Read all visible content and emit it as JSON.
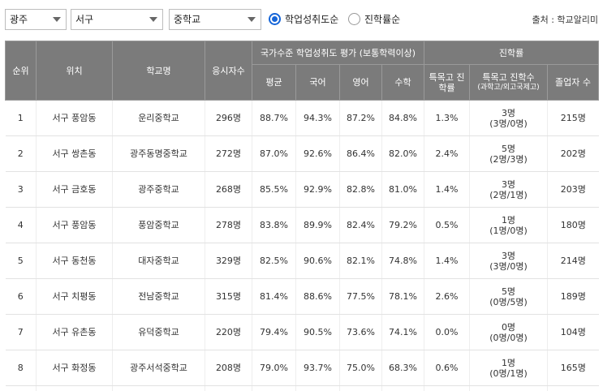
{
  "filters": {
    "region": "광주",
    "district": "서구",
    "school_level": "중학교",
    "sort_options": [
      {
        "label": "학업성취도순",
        "checked": true
      },
      {
        "label": "진학률순",
        "checked": false
      }
    ],
    "source": "출처 : 학교알리미"
  },
  "table": {
    "headers": {
      "rank": "순위",
      "location": "위치",
      "school": "학교명",
      "examinees": "응시자수",
      "achievement_group": "국가수준 학업성취도 평가 (보통학력이상)",
      "average": "평균",
      "korean": "국어",
      "english": "영어",
      "math": "수학",
      "advance_group": "진학률",
      "special_rate": "특목고 진학률",
      "special_count": "특목고 진학수",
      "special_count_sub": "(과학고/외고국제고)",
      "graduates": "졸업자 수"
    },
    "rows": [
      {
        "rank": "1",
        "location": "서구 풍암동",
        "school": "운리중학교",
        "examinees": "296명",
        "average": "88.7%",
        "korean": "94.3%",
        "english": "87.2%",
        "math": "84.8%",
        "special_rate": "1.3%",
        "special_count": "3명",
        "special_breakdown": "(3명/0명)",
        "graduates": "215명"
      },
      {
        "rank": "2",
        "location": "서구 쌍촌동",
        "school": "광주동명중학교",
        "examinees": "272명",
        "average": "87.0%",
        "korean": "92.6%",
        "english": "86.4%",
        "math": "82.0%",
        "special_rate": "2.4%",
        "special_count": "5명",
        "special_breakdown": "(2명/3명)",
        "graduates": "202명"
      },
      {
        "rank": "3",
        "location": "서구 금호동",
        "school": "광주중학교",
        "examinees": "268명",
        "average": "85.5%",
        "korean": "92.9%",
        "english": "82.8%",
        "math": "81.0%",
        "special_rate": "1.4%",
        "special_count": "3명",
        "special_breakdown": "(2명/1명)",
        "graduates": "203명"
      },
      {
        "rank": "4",
        "location": "서구 풍암동",
        "school": "풍암중학교",
        "examinees": "278명",
        "average": "83.8%",
        "korean": "89.9%",
        "english": "82.4%",
        "math": "79.2%",
        "special_rate": "0.5%",
        "special_count": "1명",
        "special_breakdown": "(1명/0명)",
        "graduates": "180명"
      },
      {
        "rank": "5",
        "location": "서구 동천동",
        "school": "대자중학교",
        "examinees": "329명",
        "average": "82.5%",
        "korean": "90.6%",
        "english": "82.1%",
        "math": "74.8%",
        "special_rate": "1.4%",
        "special_count": "3명",
        "special_breakdown": "(3명/0명)",
        "graduates": "214명"
      },
      {
        "rank": "6",
        "location": "서구 치평동",
        "school": "전남중학교",
        "examinees": "315명",
        "average": "81.4%",
        "korean": "88.6%",
        "english": "77.5%",
        "math": "78.1%",
        "special_rate": "2.6%",
        "special_count": "5명",
        "special_breakdown": "(0명/5명)",
        "graduates": "189명"
      },
      {
        "rank": "7",
        "location": "서구 유촌동",
        "school": "유덕중학교",
        "examinees": "220명",
        "average": "79.4%",
        "korean": "90.5%",
        "english": "73.6%",
        "math": "74.1%",
        "special_rate": "0.0%",
        "special_count": "0명",
        "special_breakdown": "(0명/0명)",
        "graduates": "104명"
      },
      {
        "rank": "8",
        "location": "서구 화정동",
        "school": "광주서석중학교",
        "examinees": "208명",
        "average": "79.0%",
        "korean": "93.7%",
        "english": "75.0%",
        "math": "68.3%",
        "special_rate": "0.6%",
        "special_count": "1명",
        "special_breakdown": "(0명/1명)",
        "graduates": "165명"
      }
    ]
  }
}
